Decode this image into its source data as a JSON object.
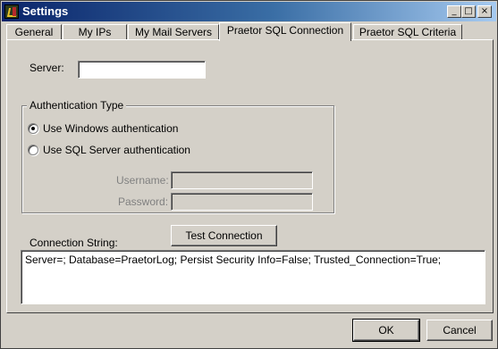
{
  "window": {
    "title": "Settings",
    "controls": {
      "minimize": "_",
      "maximize": "□",
      "close": "×"
    }
  },
  "tabs": [
    {
      "label": "General"
    },
    {
      "label": "My IPs"
    },
    {
      "label": "My Mail Servers"
    },
    {
      "label": "Praetor SQL Connection",
      "active": true
    },
    {
      "label": "Praetor SQL Criteria"
    }
  ],
  "form": {
    "server_label": "Server:",
    "server_value": "",
    "auth_group_label": "Authentication Type",
    "auth_options": [
      {
        "label": "Use Windows authentication",
        "selected": true
      },
      {
        "label": "Use SQL Server authentication",
        "selected": false
      }
    ],
    "username_label": "Username:",
    "username_value": "",
    "password_label": "Password:",
    "password_value": "",
    "test_button": "Test Connection",
    "connection_string_label": "Connection String:",
    "connection_string_value": "Server=; Database=PraetorLog; Persist Security Info=False; Trusted_Connection=True;"
  },
  "footer": {
    "ok": "OK",
    "cancel": "Cancel"
  }
}
